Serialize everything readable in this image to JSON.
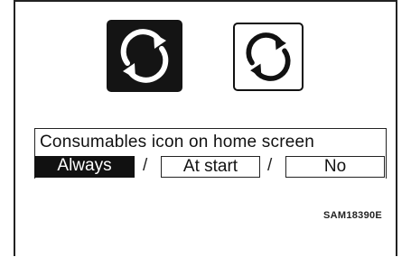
{
  "icons": {
    "active": "cycle-arrows-icon",
    "inactive": "cycle-arrows-icon"
  },
  "setting": {
    "label": "Consumables icon on home screen",
    "options": [
      "Always",
      "At start",
      "No"
    ],
    "selected": "Always",
    "separator": "/"
  },
  "figure_code": "SAM18390E",
  "colors": {
    "selected_bg": "#111111",
    "selected_text": "#ffffff",
    "ink": "#111111"
  }
}
